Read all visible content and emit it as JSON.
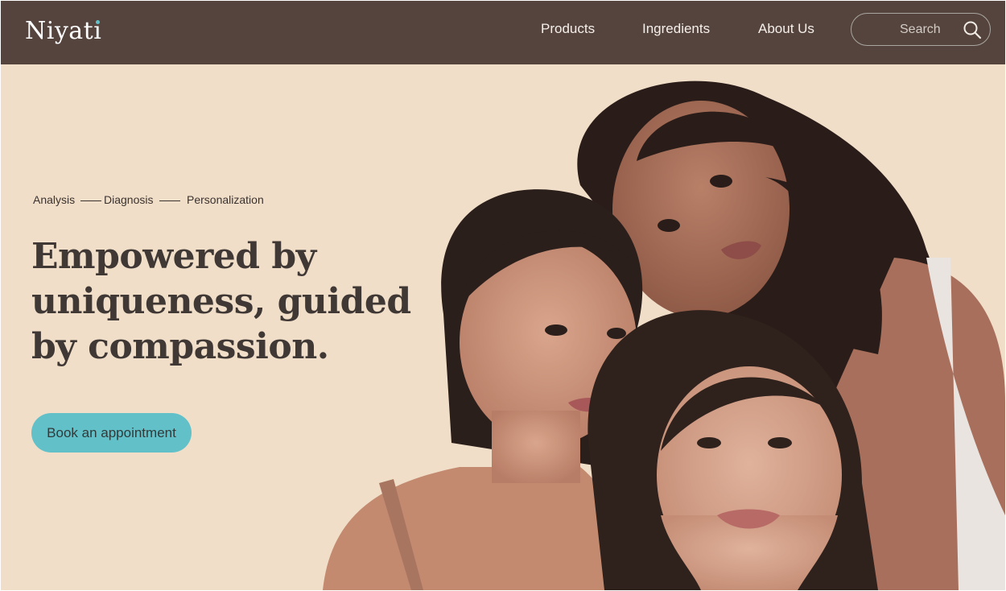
{
  "brand": {
    "name": "Niyati",
    "accent": "#62c1c8",
    "header_bg": "#55443e",
    "hero_bg": "#f0dec8"
  },
  "nav": {
    "products": "Products",
    "ingredients": "Ingredients",
    "about": "About Us"
  },
  "search": {
    "placeholder": "Search",
    "icon": "search-icon"
  },
  "hero": {
    "steps": [
      "Analysis",
      "Diagnosis",
      "Personalization"
    ],
    "headline_lines": [
      "Empowered by",
      "uniqueness, guided",
      "by compassion."
    ],
    "cta": "Book an appointment",
    "image": "three-women-portrait"
  }
}
